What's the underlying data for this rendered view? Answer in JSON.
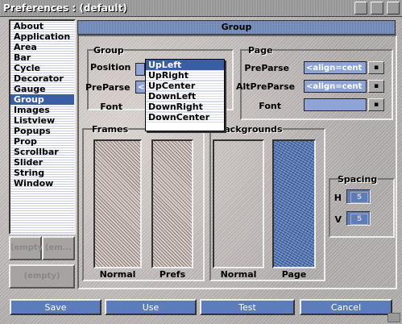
{
  "window": {
    "title": "Preferences : (default)"
  },
  "sidebar": {
    "items": [
      {
        "label": "About"
      },
      {
        "label": "Application"
      },
      {
        "label": "Area"
      },
      {
        "label": "Bar"
      },
      {
        "label": "Cycle"
      },
      {
        "label": "Decorator"
      },
      {
        "label": "Gauge"
      },
      {
        "label": "Group"
      },
      {
        "label": "Images"
      },
      {
        "label": "Listview"
      },
      {
        "label": "Popups"
      },
      {
        "label": "Prop"
      },
      {
        "label": "Scrollbar"
      },
      {
        "label": "Slider"
      },
      {
        "label": "String"
      },
      {
        "label": "Window"
      }
    ],
    "selected": "Group",
    "btn_a": "(empty)",
    "btn_b": "(em...",
    "btn_c": "(empty)"
  },
  "header": {
    "title": "Group"
  },
  "group_frame": {
    "title": "Group",
    "position_label": "Position",
    "preparse_label": "PreParse",
    "font_label": "Font",
    "preparse_value": "<ali"
  },
  "page_frame": {
    "title": "Page",
    "preparse_label": "PreParse",
    "altpreparse_label": "AltPreParse",
    "font_label": "Font",
    "preparse_value": "<align=cent",
    "altpreparse_value": "<align=cent",
    "font_value": ""
  },
  "frames_frame": {
    "title": "Frames",
    "normal_label": "Normal",
    "prefs_label": "Prefs"
  },
  "backgrounds_frame": {
    "title": "Backgrounds",
    "normal_label": "Normal",
    "page_label": "Page"
  },
  "spacing": {
    "title": "Spacing",
    "h_label": "H",
    "v_label": "V",
    "h_value": "5",
    "v_value": "5"
  },
  "dropdown": {
    "options": [
      {
        "label": "UpLeft"
      },
      {
        "label": "UpRight"
      },
      {
        "label": "UpCenter"
      },
      {
        "label": "DownLeft"
      },
      {
        "label": "DownRight"
      },
      {
        "label": "DownCenter"
      }
    ],
    "selected": "UpLeft"
  },
  "footer": {
    "save": "Save",
    "use": "Use",
    "test": "Test",
    "cancel": "Cancel"
  },
  "colors": {
    "accent": "#3a5ea4",
    "button": "#5c7cba",
    "field": "#8fa4d6"
  }
}
